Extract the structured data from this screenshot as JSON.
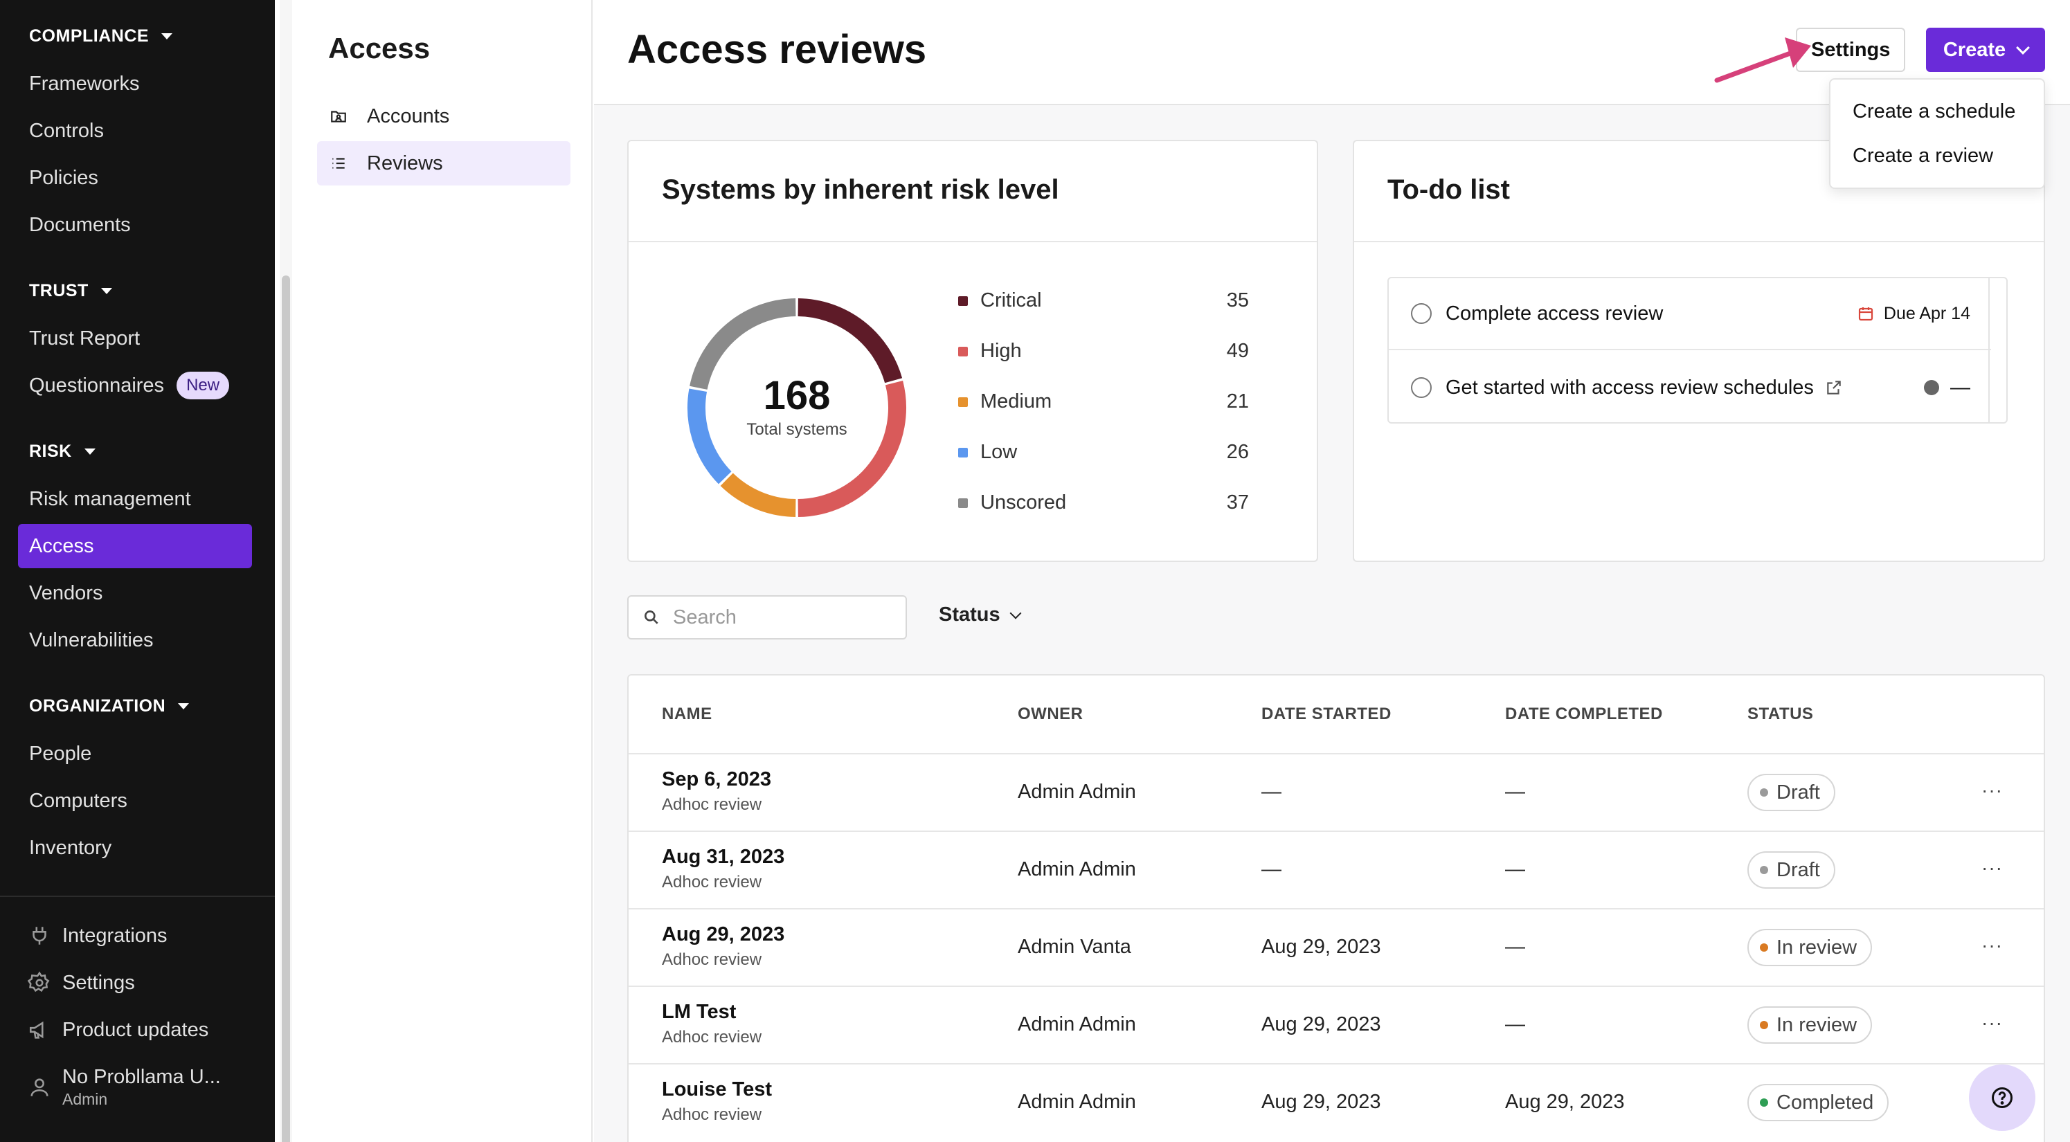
{
  "sidebar": {
    "sections": [
      {
        "title": "COMPLIANCE",
        "items": [
          "Frameworks",
          "Controls",
          "Policies",
          "Documents"
        ]
      },
      {
        "title": "TRUST",
        "items": [
          "Trust Report",
          "Questionnaires"
        ]
      },
      {
        "title": "RISK",
        "items": [
          "Risk management",
          "Access",
          "Vendors",
          "Vulnerabilities"
        ]
      },
      {
        "title": "ORGANIZATION",
        "items": [
          "People",
          "Computers",
          "Inventory"
        ]
      }
    ],
    "new_badge": "New",
    "active_item": "Access",
    "footer": {
      "integrations": "Integrations",
      "settings": "Settings",
      "product_updates": "Product updates",
      "user_name": "No Probllama U...",
      "user_role": "Admin"
    },
    "icons": [
      "plug-icon",
      "gear-icon",
      "megaphone-icon",
      "user-icon"
    ]
  },
  "subnav": {
    "title": "Access",
    "items": [
      {
        "label": "Accounts",
        "icon": "folder-user-icon"
      },
      {
        "label": "Reviews",
        "icon": "list-icon",
        "active": true
      }
    ]
  },
  "header": {
    "title": "Access reviews",
    "settings_label": "Settings",
    "create_label": "Create",
    "create_menu": [
      "Create a schedule",
      "Create a review"
    ]
  },
  "risk_card": {
    "title": "Systems by inherent risk level",
    "total": "168",
    "total_label": "Total systems",
    "legend": [
      {
        "label": "Critical",
        "value": "35",
        "color": "#5e1b28"
      },
      {
        "label": "High",
        "value": "49",
        "color": "#d95a5a"
      },
      {
        "label": "Medium",
        "value": "21",
        "color": "#e6922e"
      },
      {
        "label": "Low",
        "value": "26",
        "color": "#5b97ef"
      },
      {
        "label": "Unscored",
        "value": "37",
        "color": "#8a8a8a"
      }
    ]
  },
  "chart_data": {
    "type": "pie",
    "categories": [
      "Critical",
      "High",
      "Medium",
      "Low",
      "Unscored"
    ],
    "values": [
      35,
      49,
      21,
      26,
      37
    ],
    "colors": [
      "#5e1b28",
      "#d95a5a",
      "#e6922e",
      "#5b97ef",
      "#8a8a8a"
    ]
  },
  "todo": {
    "title": "To-do list",
    "items": [
      {
        "label": "Complete access review",
        "due": "Due Apr 14"
      },
      {
        "label": "Get started with access review schedules",
        "due": "—"
      }
    ]
  },
  "filters": {
    "search_placeholder": "Search",
    "status_label": "Status"
  },
  "table": {
    "columns": [
      "NAME",
      "OWNER",
      "DATE STARTED",
      "DATE COMPLETED",
      "STATUS"
    ],
    "rows": [
      {
        "name": "Sep 6, 2023",
        "type": "Adhoc review",
        "owner": "Admin Admin",
        "started": "—",
        "completed": "—",
        "status": "Draft",
        "status_color": "#9a9a9a"
      },
      {
        "name": "Aug 31, 2023",
        "type": "Adhoc review",
        "owner": "Admin Admin",
        "started": "—",
        "completed": "—",
        "status": "Draft",
        "status_color": "#9a9a9a"
      },
      {
        "name": "Aug 29, 2023",
        "type": "Adhoc review",
        "owner": "Admin Vanta",
        "started": "Aug 29, 2023",
        "completed": "—",
        "status": "In review",
        "status_color": "#d97a22"
      },
      {
        "name": "LM Test",
        "type": "Adhoc review",
        "owner": "Admin Admin",
        "started": "Aug 29, 2023",
        "completed": "—",
        "status": "In review",
        "status_color": "#d97a22"
      },
      {
        "name": "Louise Test",
        "type": "Adhoc review",
        "owner": "Admin Admin",
        "started": "Aug 29, 2023",
        "completed": "Aug 29, 2023",
        "status": "Completed",
        "status_color": "#2f9e55"
      }
    ],
    "more_label": "···"
  },
  "colors": {
    "accent": "#6a2bd9",
    "sidebar_bg": "#141414",
    "annotation_arrow": "#d6407a"
  }
}
